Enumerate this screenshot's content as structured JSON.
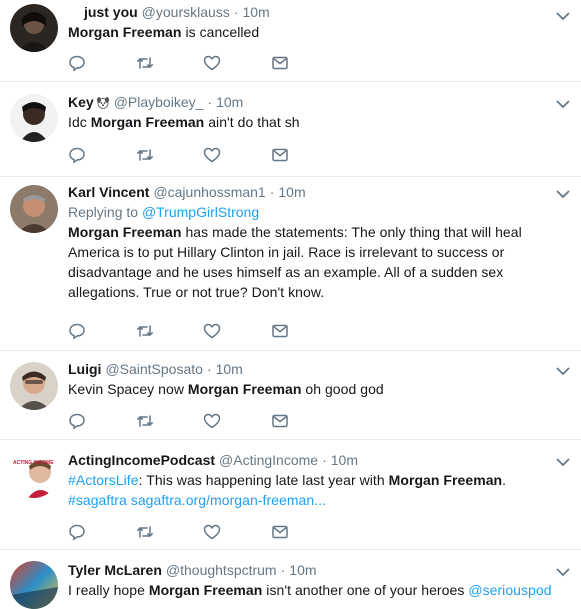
{
  "tweets": [
    {
      "name": "just you",
      "handle": "@yoursklauss",
      "time": "10m",
      "text_parts": [
        {
          "t": "Morgan Freeman",
          "bold": true
        },
        {
          "t": " is cancelled"
        }
      ]
    },
    {
      "name": "Key",
      "handle": "@Playboikey_",
      "time": "10m",
      "text_parts": [
        {
          "t": "Idc "
        },
        {
          "t": "Morgan Freeman",
          "bold": true
        },
        {
          "t": " ain't do that sh"
        }
      ]
    },
    {
      "name": "Karl Vincent",
      "handle": "@cajunhossman1",
      "time": "10m",
      "replying_label": "Replying to",
      "replying_to": "@TrumpGirlStrong",
      "text_parts": [
        {
          "t": "Morgan Freeman",
          "bold": true
        },
        {
          "t": " has made the statements: The only thing that will heal America is to put Hillary Clinton in jail.  Race is irrelevant to success or disadvantage and he uses himself as an example.  All of a sudden sex allegations.  True or not true? Don't know."
        }
      ]
    },
    {
      "name": "Luigi",
      "handle": "@SaintSposato",
      "time": "10m",
      "text_parts": [
        {
          "t": "Kevin Spacey now "
        },
        {
          "t": "Morgan Freeman",
          "bold": true
        },
        {
          "t": " oh good god"
        }
      ]
    },
    {
      "name": "ActingIncomePodcast",
      "handle": "@ActingIncome",
      "time": "10m",
      "text_parts": [
        {
          "t": "#ActorsLife",
          "link": true
        },
        {
          "t": ": This was happening late last year with "
        },
        {
          "t": "Morgan Freeman",
          "bold": true
        },
        {
          "t": ". "
        },
        {
          "t": "#sagaftra",
          "link": true
        },
        {
          "t": " "
        },
        {
          "t": "sagaftra.org/morgan-freeman...",
          "link": true
        }
      ],
      "avatar_label": "ACTING INCOME"
    },
    {
      "name": "Tyler McLaren",
      "handle": "@thoughtspctrum",
      "time": "10m",
      "text_parts": [
        {
          "t": "I really hope "
        },
        {
          "t": "Morgan Freeman",
          "bold": true
        },
        {
          "t": " isn't another one of your heroes "
        },
        {
          "t": "@seriouspod",
          "link": true
        }
      ]
    }
  ],
  "separator": "·",
  "icons": {
    "reply": "reply-icon",
    "retweet": "retweet-icon",
    "like": "like-icon",
    "message": "message-icon",
    "caret": "chevron-down-icon"
  },
  "colors": {
    "link": "#1da1f2",
    "secondary": "#657786",
    "icon": "#657786",
    "divider": "#e6ecf0"
  }
}
